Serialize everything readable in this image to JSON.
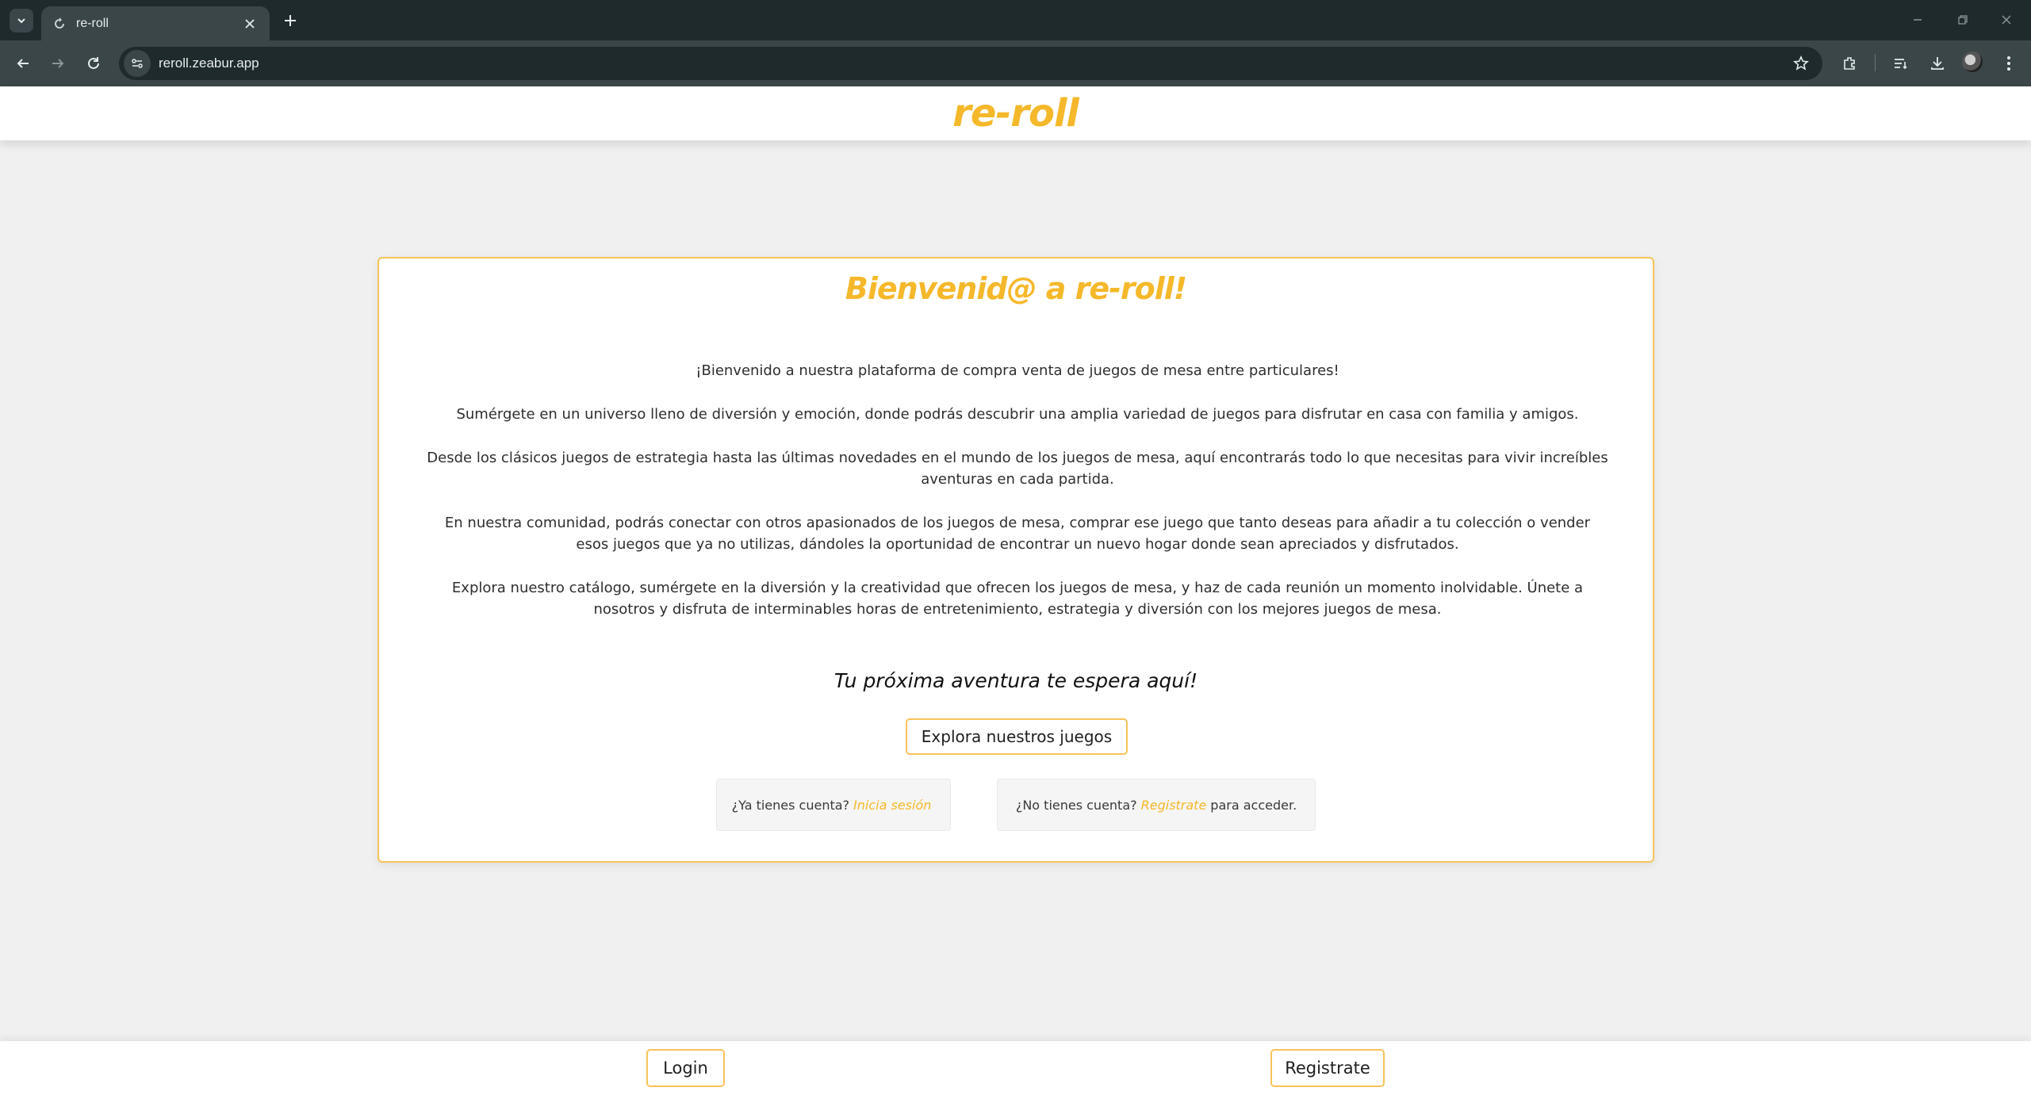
{
  "browser": {
    "tab_title": "re-roll",
    "url": "reroll.zeabur.app"
  },
  "header": {
    "logo": "re-roll"
  },
  "card": {
    "title": "Bienvenid@ a re-roll!",
    "paragraphs": [
      "¡Bienvenido a nuestra plataforma de compra venta de juegos de mesa entre particulares!",
      "Sumérgete en un universo lleno de diversión y emoción, donde podrás descubrir una amplia variedad de juegos para disfrutar en casa con familia y amigos.",
      "Desde los clásicos juegos de estrategia hasta las últimas novedades en el mundo de los juegos de mesa, aquí encontrarás todo lo que necesitas para vivir increíbles aventuras en cada partida.",
      "En nuestra comunidad, podrás conectar con otros apasionados de los juegos de mesa, comprar ese juego que tanto deseas para añadir a tu colección o vender esos juegos que ya no utilizas, dándoles la oportunidad de encontrar un nuevo hogar donde sean apreciados y disfrutados.",
      "Explora nuestro catálogo, sumérgete en la diversión y la creatividad que ofrecen los juegos de mesa, y haz de cada reunión un momento inolvidable. Únete a nosotros y disfruta de interminables horas de entretenimiento, estrategia y diversión con los mejores juegos de mesa."
    ],
    "tagline": "Tu próxima aventura te espera aquí!",
    "cta_label": "Explora nuestros juegos",
    "login_note": {
      "prefix": "¿Ya tienes cuenta?",
      "link": "Inicia sesión"
    },
    "register_note": {
      "prefix": "¿No tienes cuenta?",
      "link": "Registrate",
      "suffix": "para acceder."
    }
  },
  "footer": {
    "login_label": "Login",
    "register_label": "Registrate"
  },
  "colors": {
    "accent": "#f5b82a",
    "border": "#f7c35a",
    "chrome_dark": "#1f2a2d",
    "chrome_mid": "#3b4649",
    "page_bg": "#f0f0f0"
  },
  "icons": [
    "tab-search-icon",
    "reload-favicon",
    "close-icon",
    "plus-icon",
    "minimize-icon",
    "restore-icon",
    "window-close-icon",
    "back-arrow-icon",
    "forward-arrow-icon",
    "reload-icon",
    "site-info-icon",
    "star-icon",
    "extensions-icon",
    "reading-list-icon",
    "download-icon",
    "profile-avatar",
    "menu-dots-icon"
  ]
}
